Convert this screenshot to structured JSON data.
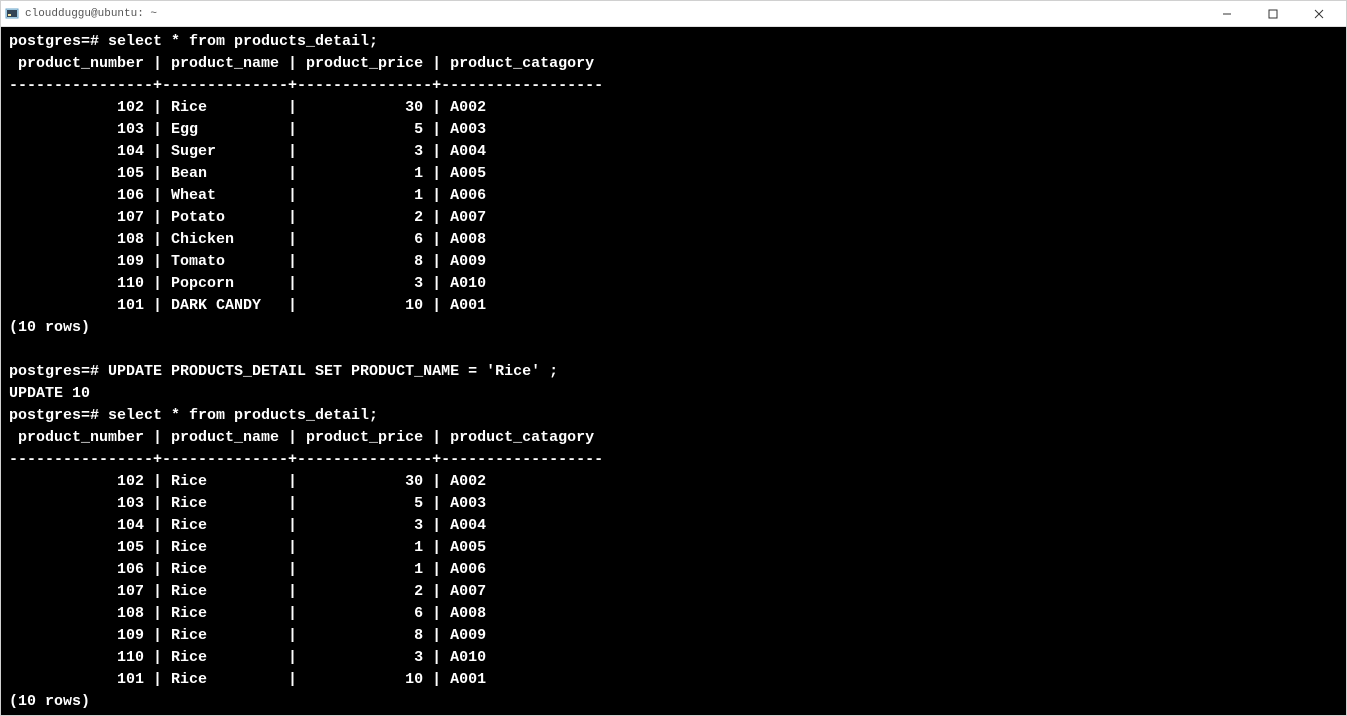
{
  "titlebar": {
    "title": "cloudduggu@ubuntu: ~"
  },
  "terminal": {
    "prompt": "postgres=#",
    "query1": "select * from products_detail;",
    "header": {
      "col1": "product_number",
      "col2": "product_name",
      "col3": "product_price",
      "col4": "product_catagory"
    },
    "separator": "----------------+--------------+---------------+------------------",
    "table1": [
      {
        "number": "102",
        "name": "Rice",
        "price": "30",
        "category": "A002"
      },
      {
        "number": "103",
        "name": "Egg",
        "price": "5",
        "category": "A003"
      },
      {
        "number": "104",
        "name": "Suger",
        "price": "3",
        "category": "A004"
      },
      {
        "number": "105",
        "name": "Bean",
        "price": "1",
        "category": "A005"
      },
      {
        "number": "106",
        "name": "Wheat",
        "price": "1",
        "category": "A006"
      },
      {
        "number": "107",
        "name": "Potato",
        "price": "2",
        "category": "A007"
      },
      {
        "number": "108",
        "name": "Chicken",
        "price": "6",
        "category": "A008"
      },
      {
        "number": "109",
        "name": "Tomato",
        "price": "8",
        "category": "A009"
      },
      {
        "number": "110",
        "name": "Popcorn",
        "price": "3",
        "category": "A010"
      },
      {
        "number": "101",
        "name": "DARK CANDY",
        "price": "10",
        "category": "A001"
      }
    ],
    "rowcount1": "(10 rows)",
    "query2": "UPDATE PRODUCTS_DETAIL SET PRODUCT_NAME = 'Rice' ;",
    "update_result": "UPDATE 10",
    "query3": "select * from products_detail;",
    "table2": [
      {
        "number": "102",
        "name": "Rice",
        "price": "30",
        "category": "A002"
      },
      {
        "number": "103",
        "name": "Rice",
        "price": "5",
        "category": "A003"
      },
      {
        "number": "104",
        "name": "Rice",
        "price": "3",
        "category": "A004"
      },
      {
        "number": "105",
        "name": "Rice",
        "price": "1",
        "category": "A005"
      },
      {
        "number": "106",
        "name": "Rice",
        "price": "1",
        "category": "A006"
      },
      {
        "number": "107",
        "name": "Rice",
        "price": "2",
        "category": "A007"
      },
      {
        "number": "108",
        "name": "Rice",
        "price": "6",
        "category": "A008"
      },
      {
        "number": "109",
        "name": "Rice",
        "price": "8",
        "category": "A009"
      },
      {
        "number": "110",
        "name": "Rice",
        "price": "3",
        "category": "A010"
      },
      {
        "number": "101",
        "name": "Rice",
        "price": "10",
        "category": "A001"
      }
    ],
    "rowcount2": "(10 rows)"
  }
}
